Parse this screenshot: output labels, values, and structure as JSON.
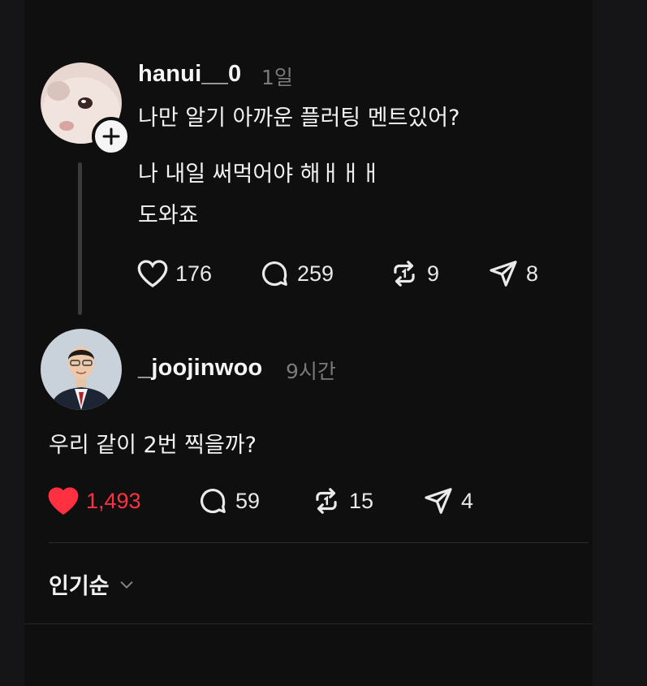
{
  "post": {
    "username": "hanui__0",
    "time": "1일",
    "line1": "나만 알기 아까운 플러팅 멘트있어?",
    "line2": "나 내일 써먹어야 해ㅐㅐㅐ",
    "line3": "도와죠",
    "likes": "176",
    "comments": "259",
    "reposts": "9",
    "shares": "8"
  },
  "reply": {
    "username": "_joojinwoo",
    "time": "9시간",
    "text": "우리 같이 2번 찍을까?",
    "likes": "1,493",
    "liked": true,
    "comments": "59",
    "reposts": "15",
    "shares": "4"
  },
  "sort": {
    "label": "인기순"
  },
  "colors": {
    "liked": "#ff3040",
    "muted": "#7a7a7a",
    "background": "#0f0f10"
  }
}
